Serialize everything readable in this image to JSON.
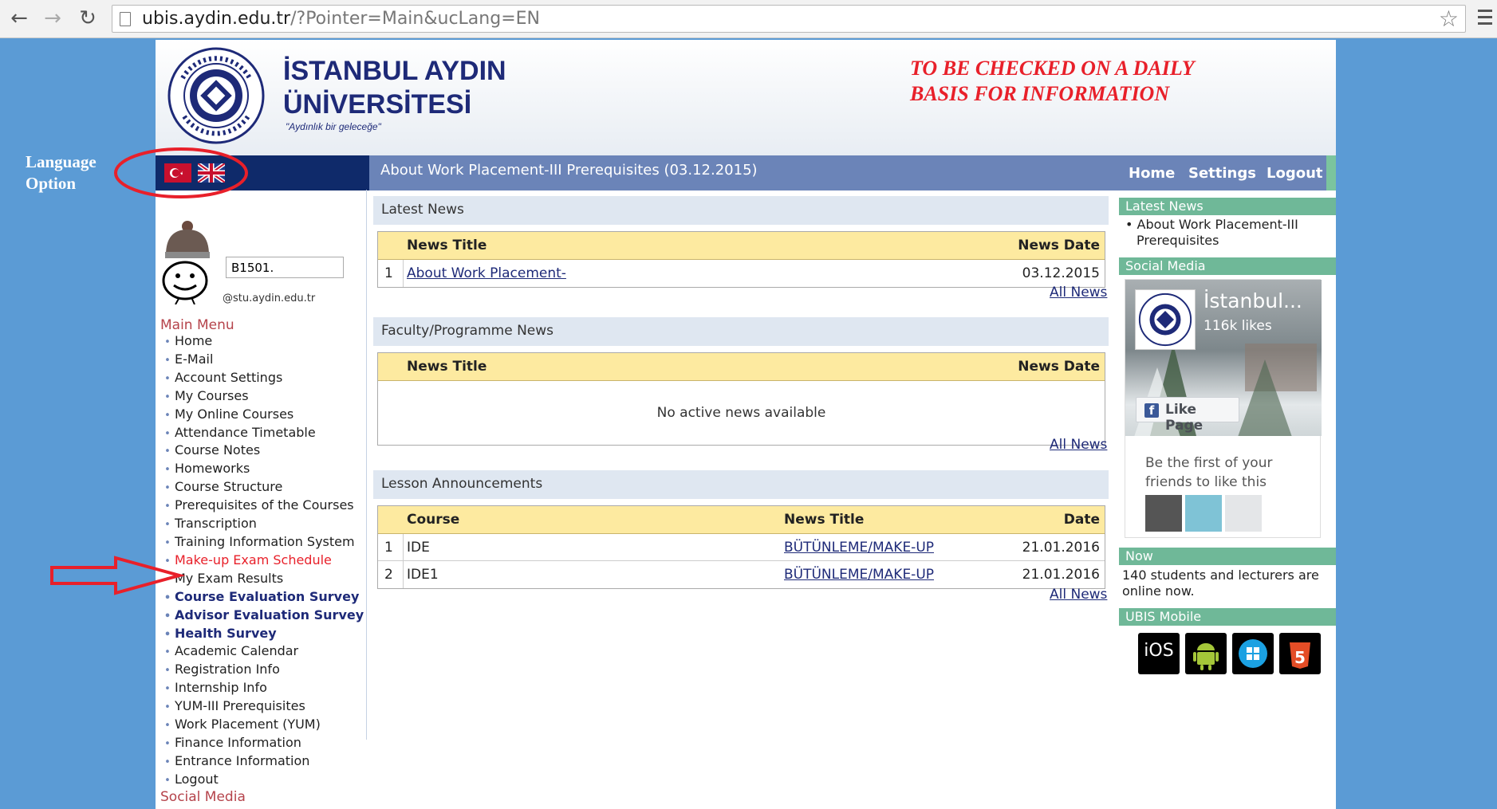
{
  "browser": {
    "url_host": "ubis.aydin.edu.tr",
    "url_path": "/?Pointer=Main&ucLang=EN"
  },
  "header": {
    "uni_line1": "İSTANBUL AYDIN",
    "uni_line2": "ÜNİVERSİTESİ",
    "slogan": "\"Aydınlık bir geleceğe\"",
    "notice_line1": "TO BE CHECKED ON A DAILY",
    "notice_line2": "BASIS FOR INFORMATION"
  },
  "annotations": {
    "language_line1": "Language",
    "language_line2": "Option"
  },
  "topbar": {
    "title": "About Work Placement-III Prerequisites (03.12.2015)",
    "home": "Home",
    "settings": "Settings",
    "logout": "Logout"
  },
  "profile": {
    "student_id": "B1501.",
    "email": "@stu.aydin.edu.tr"
  },
  "sidebar": {
    "main_menu_title": "Main Menu",
    "items": [
      {
        "label": "Home",
        "style": "normal"
      },
      {
        "label": "E-Mail",
        "style": "normal"
      },
      {
        "label": "Account Settings",
        "style": "normal"
      },
      {
        "label": "My Courses",
        "style": "normal"
      },
      {
        "label": "My Online Courses",
        "style": "normal"
      },
      {
        "label": "Attendance Timetable",
        "style": "normal"
      },
      {
        "label": "Course Notes",
        "style": "normal"
      },
      {
        "label": "Homeworks",
        "style": "normal"
      },
      {
        "label": "Course Structure",
        "style": "normal"
      },
      {
        "label": "Prerequisites of the Courses",
        "style": "normal"
      },
      {
        "label": "Transcription",
        "style": "normal"
      },
      {
        "label": "Training Information System",
        "style": "normal"
      },
      {
        "label": "Make-up Exam Schedule",
        "style": "red"
      },
      {
        "label": "My Exam Results",
        "style": "normal"
      },
      {
        "label": "Course Evaluation Survey",
        "style": "bold"
      },
      {
        "label": "Advisor Evaluation Survey",
        "style": "bold"
      },
      {
        "label": "Health Survey",
        "style": "bold"
      },
      {
        "label": "Academic Calendar",
        "style": "normal"
      },
      {
        "label": "Registration Info",
        "style": "normal"
      },
      {
        "label": "Internship Info",
        "style": "normal"
      },
      {
        "label": "YUM-III Prerequisites",
        "style": "normal"
      },
      {
        "label": "Work Placement (YUM)",
        "style": "normal"
      },
      {
        "label": "Finance Information",
        "style": "normal"
      },
      {
        "label": "Entrance Information",
        "style": "normal"
      },
      {
        "label": "Logout",
        "style": "normal"
      }
    ],
    "social_media_title": "Social Media"
  },
  "latest_news": {
    "heading": "Latest News",
    "col_title": "News Title",
    "col_date": "News Date",
    "rows": [
      {
        "num": "1",
        "title": "About Work Placement-",
        "date": "03.12.2015"
      }
    ],
    "all_news": "All News"
  },
  "faculty_news": {
    "heading": "Faculty/Programme News",
    "col_title": "News Title",
    "col_date": "News Date",
    "empty": "No active news available",
    "all_news": "All News"
  },
  "lessons": {
    "heading": "Lesson Announcements",
    "col_course": "Course",
    "col_title": "News Title",
    "col_date": "Date",
    "rows": [
      {
        "num": "1",
        "course": "IDE",
        "title": "BÜTÜNLEME/MAKE-UP",
        "date": "21.01.2016"
      },
      {
        "num": "2",
        "course": "IDE1",
        "title": "BÜTÜNLEME/MAKE-UP",
        "date": "21.01.2016"
      }
    ],
    "all_news": "All News"
  },
  "right": {
    "latest_news_title": "Latest News",
    "latest_news_item": "About Work Placement-III Prerequisites",
    "social_media_title": "Social Media",
    "fb_name": "İstanbul...",
    "fb_likes": "116k likes",
    "fb_like_button": "Like Page",
    "fb_first": "Be the first of your friends to like this",
    "now_title": "Now",
    "now_text": "140 students and lecturers are online now.",
    "mobile_title": "UBIS Mobile",
    "apps": [
      "iOS",
      "Android",
      "Windows",
      "HTML5"
    ]
  },
  "colors": {
    "accent_navy": "#1e2a78",
    "bar_blue": "#6b84b8",
    "green_head": "#6fb898",
    "annotation_red": "#e8202a",
    "table_head": "#fdeaa0"
  }
}
